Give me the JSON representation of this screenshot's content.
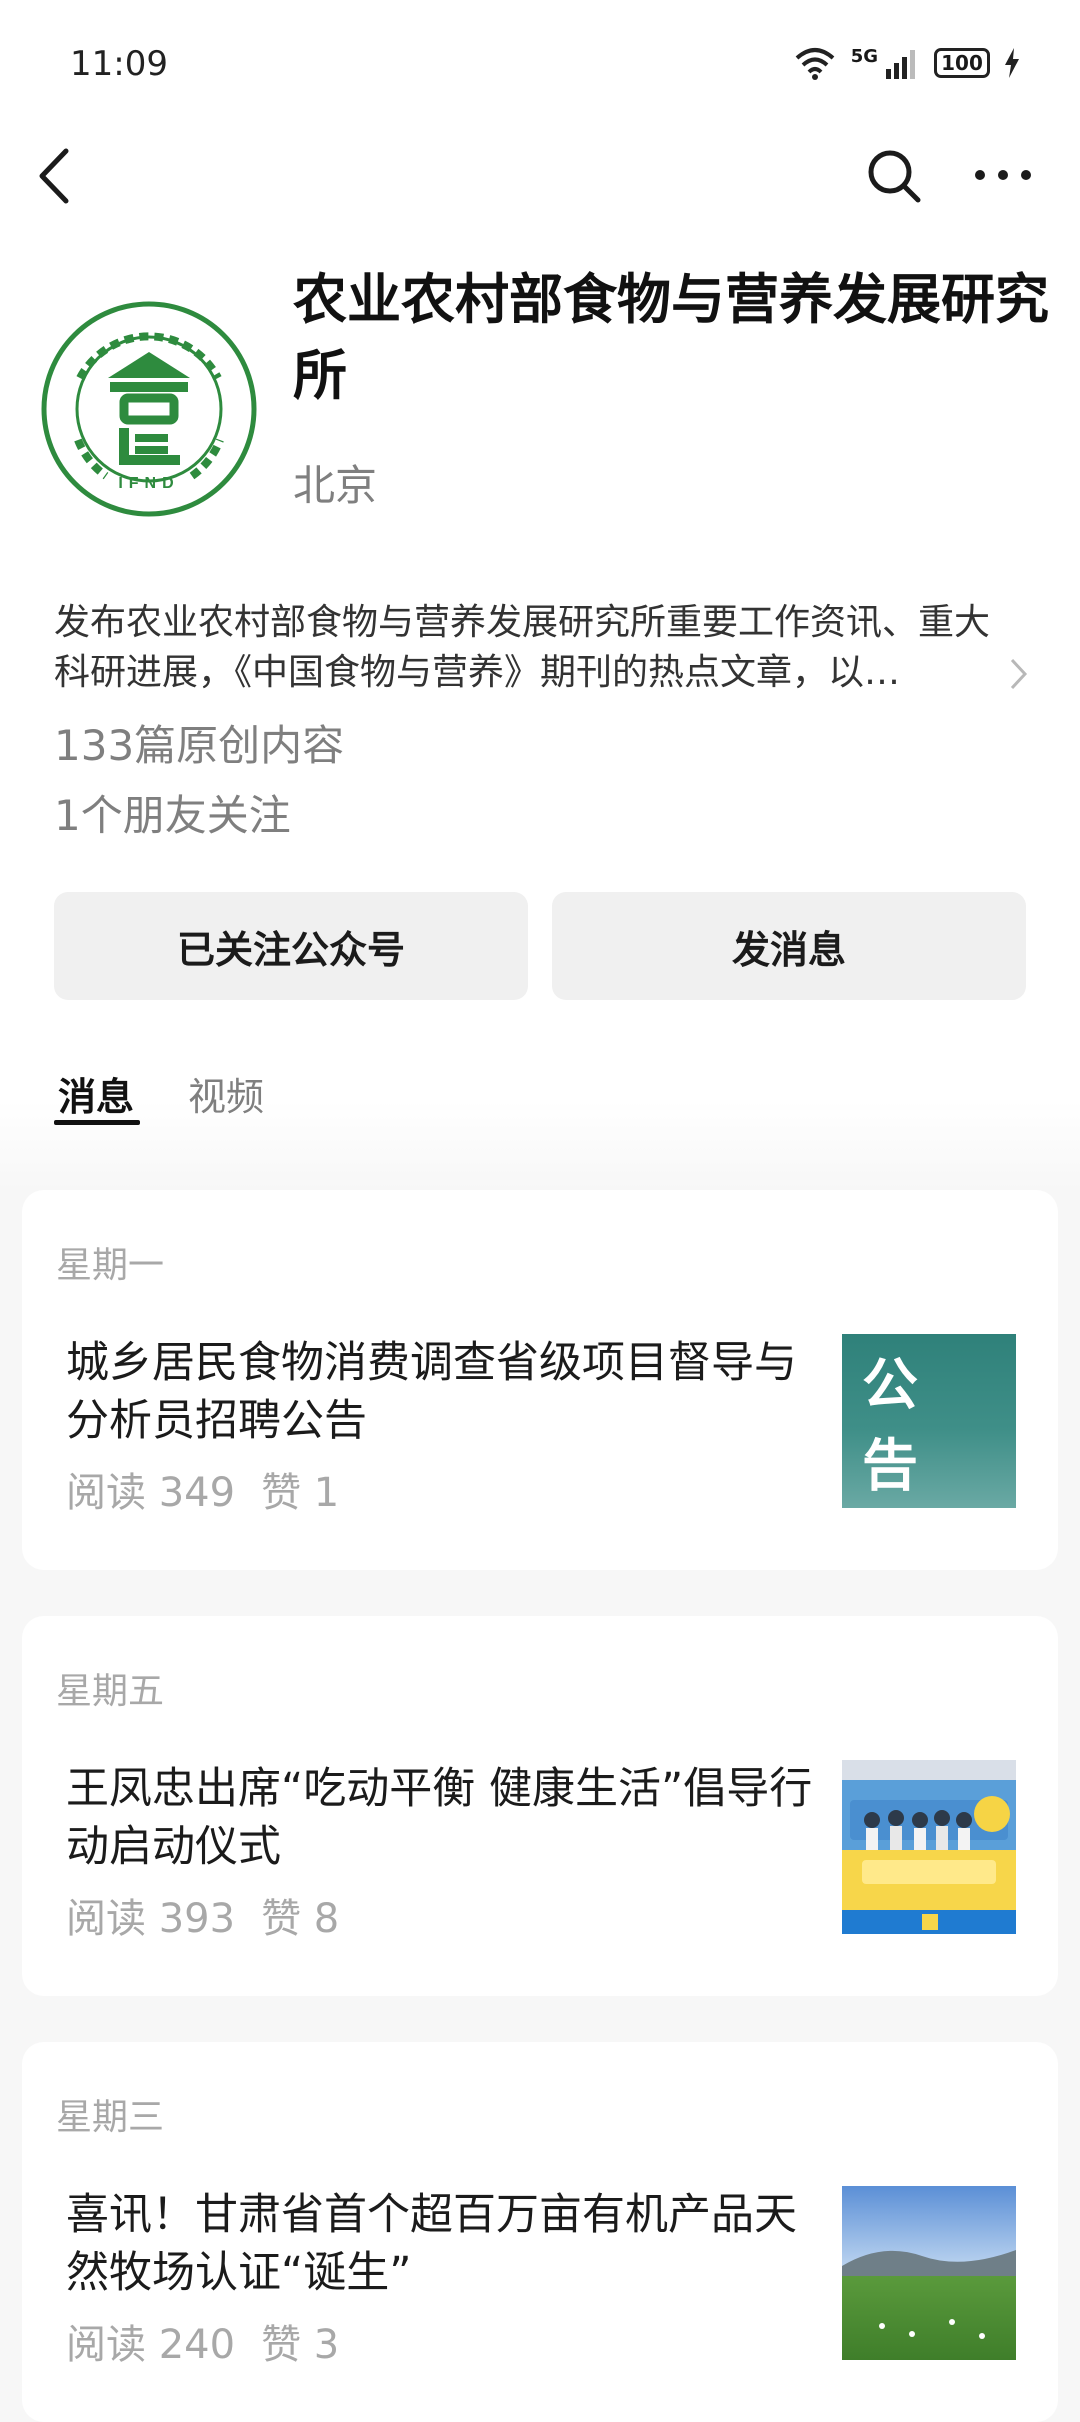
{
  "status_bar": {
    "time": "11:09",
    "network": "5G",
    "battery": "100"
  },
  "profile": {
    "name": "农业农村部食物与营养发展研究所",
    "location": "北京",
    "description": "发布农业农村部食物与营养发展研究所重要工作资讯、重大科研进展，《中国食物与营养》期刊的热点文章，以…",
    "original_count": "133篇原创内容",
    "friends_following": "1个朋友关注",
    "logo_text": "IFND"
  },
  "actions": {
    "followed_label": "已关注公众号",
    "message_label": "发消息"
  },
  "tabs": [
    {
      "label": "消息"
    },
    {
      "label": "视频"
    }
  ],
  "articles": [
    {
      "day": "星期一",
      "title": "城乡居民食物消费调查省级项目督导与分析员招聘公告",
      "reads": "阅读 349",
      "likes": "赞 1",
      "thumb_text": "公告"
    },
    {
      "day": "星期五",
      "title": "王凤忠出席“吃动平衡 健康生活”倡导行动启动仪式",
      "reads": "阅读 393",
      "likes": "赞 8"
    },
    {
      "day": "星期三",
      "title": "喜讯！甘肃省首个超百万亩有机产品天然牧场认证“诞生”",
      "reads": "阅读 240",
      "likes": "赞 3"
    }
  ],
  "colors": {
    "logo_green": "#2e8b3e",
    "notice_teal": "#2f817a"
  }
}
